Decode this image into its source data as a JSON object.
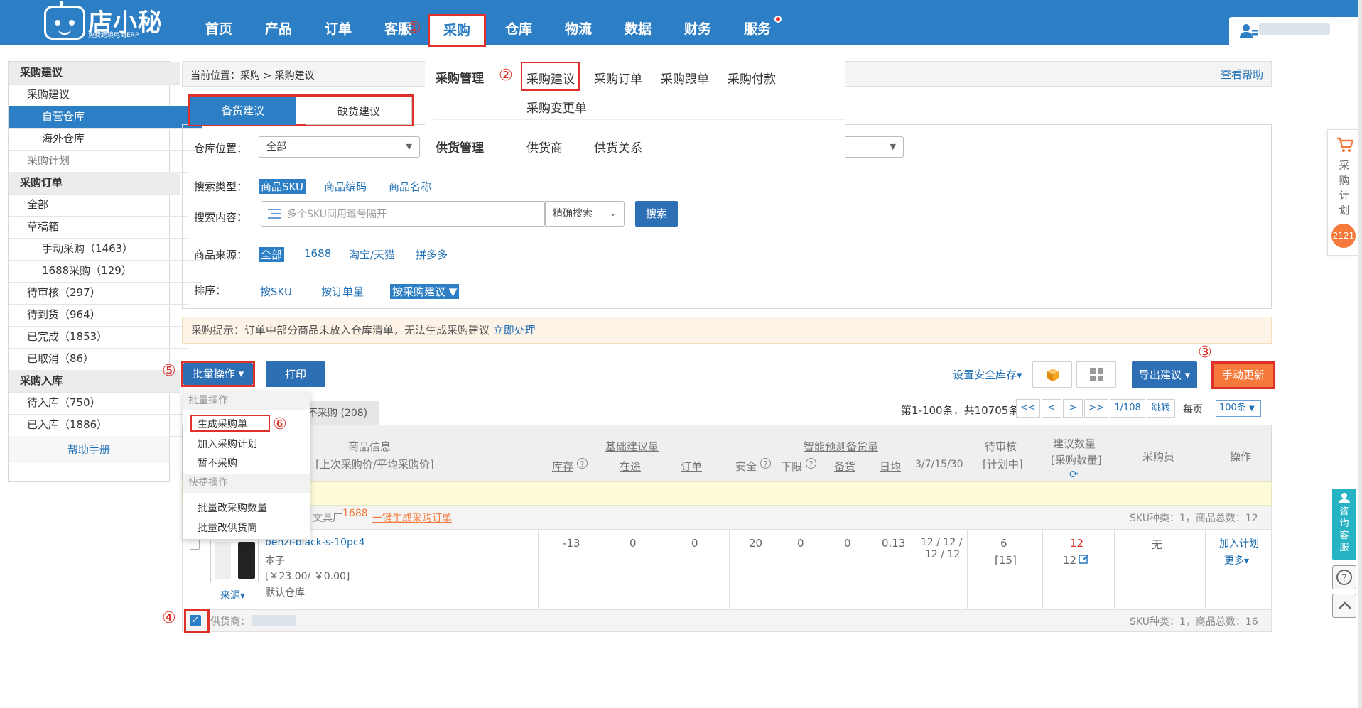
{
  "brand": {
    "name": "店小秘",
    "tagline": "免费跨境电商ERP"
  },
  "nav": {
    "items": [
      "首页",
      "产品",
      "订单",
      "客服",
      "采购",
      "仓库",
      "物流",
      "数据",
      "财务",
      "服务"
    ],
    "active": "采购"
  },
  "steps": [
    "①",
    "②",
    "③",
    "④",
    "⑤",
    "⑥"
  ],
  "sidebar": {
    "sections": [
      {
        "title": "采购建议",
        "items": [
          "采购建议",
          "自营仓库",
          "海外仓库",
          "采购计划"
        ]
      },
      {
        "title": "采购订单",
        "items": [
          "全部",
          "草稿箱",
          "手动采购（1463）",
          "1688采购（129）",
          "待审核（297）",
          "待到货（964）",
          "已完成（1853）",
          "已取消（86）"
        ]
      },
      {
        "title": "采购入库",
        "items": [
          "待入库（750）",
          "已入库（1886）"
        ]
      }
    ],
    "selected": "自营仓库",
    "help": "帮助手册"
  },
  "breadcrumb": {
    "text": "当前位置：采购 > 采购建议",
    "help": "查看帮助"
  },
  "megamenu": {
    "purchase_title": "采购管理",
    "purchase_items": [
      "采购建议",
      "采购订单",
      "采购跟单",
      "采购付款",
      "采购变更单"
    ],
    "supply_title": "供货管理",
    "supply_items": [
      "供货商",
      "供货关系"
    ]
  },
  "subtabs": {
    "stock": "备货建议",
    "shortage": "缺货建议"
  },
  "filters": {
    "warehouse_label": "仓库位置：",
    "warehouse_value": "全部",
    "search_type_label": "搜索类型：",
    "search_types": [
      "商品SKU",
      "商品编码",
      "商品名称"
    ],
    "search_content_label": "搜索内容：",
    "search_placeholder": "多个SKU间用逗号隔开",
    "match_mode": "精确搜索",
    "search_button": "搜索",
    "source_label": "商品来源：",
    "sources": [
      "全部",
      "1688",
      "淘宝/天猫",
      "拼多多"
    ],
    "sort_label": "排序：",
    "sorts": [
      "按SKU",
      "按订单量",
      "按采购建议 ▼"
    ]
  },
  "notice": {
    "text": "采购提示：订单中部分商品未放入仓库清单，无法生成采购建议",
    "link": "立即处理"
  },
  "toolbar": {
    "batch": "批量操作 ▾",
    "print": "打印",
    "safety_stock": "设置安全库存▾",
    "export": "导出建议 ▾",
    "manual_update": "手动更新"
  },
  "dropdown": {
    "group1": "批量操作",
    "items1": [
      "生成采购单",
      "加入采购计划",
      "暂不采购"
    ],
    "group2": "快捷操作",
    "items2": [
      "批量改采购数量",
      "批量改供货商"
    ]
  },
  "list_tab": "不采购 (208)",
  "pager": {
    "summary": "第1-100条，共10705条",
    "first": "<<",
    "prev": "<",
    "next": ">",
    "last": ">>",
    "page": "1/108",
    "jump": "跳转",
    "per_page_label": "每页",
    "per_page": "100条"
  },
  "table": {
    "headers": {
      "product": "商品信息",
      "product_sub": "[上次采购价/平均采购价]",
      "basic": "基础建议量",
      "basic_cols": [
        "库存",
        "在途",
        "订单"
      ],
      "smart": "智能预测备货量",
      "smart_cols": [
        "安全",
        "下限",
        "备货",
        "日均",
        "3/7/15/30"
      ],
      "pending": "待审核",
      "pending_sub": "[计划中]",
      "suggest": "建议数量",
      "suggest_sub": "[采购数量]",
      "buyer": "采购员",
      "ops": "操作"
    },
    "group1": {
      "supplier_tail": "文具厂",
      "platform": "1688",
      "action": "一键生成采购订单",
      "stats": "SKU种类：1，商品总数：12"
    },
    "row": {
      "sku": "benzi-black-s-10pc4",
      "name": "本子",
      "price": "[￥23.00/ ￥0.00]",
      "warehouse": "默认仓库",
      "source": "来源▾",
      "stock": "-13",
      "transit": "0",
      "order": "0",
      "safe": "20",
      "lower": "0",
      "stockup": "0",
      "daily": "0.13",
      "trend_a": "12 / 12 /",
      "trend_b": "12 / 12",
      "pending": "6",
      "pending_plan": "[15]",
      "suggest": "12",
      "suggest_qty": "12",
      "buyer": "无",
      "add_plan": "加入计划",
      "more": "更多▾"
    },
    "group2": {
      "supplier_label": "供货商：",
      "stats": "SKU种类：1，商品总数：16"
    }
  },
  "right_float": {
    "label": "采购计划",
    "count": "2121",
    "consult": "咨询客服"
  },
  "colors": {
    "brand": "#2d7fc5",
    "marker": "#e0302a",
    "orange": "#f5793a"
  }
}
